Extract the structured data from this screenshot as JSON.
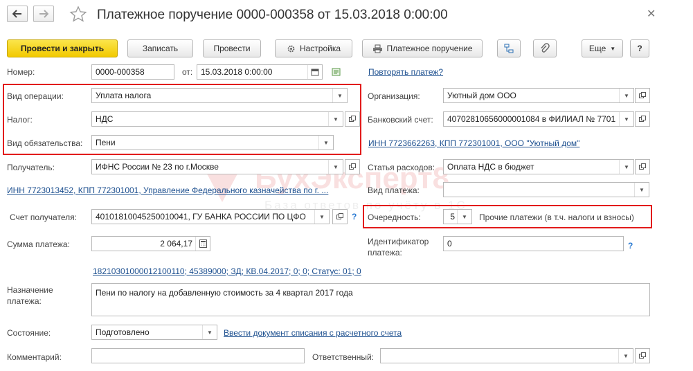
{
  "title": "Платежное поручение 0000-000358 от 15.03.2018 0:00:00",
  "toolbar": {
    "post_close": "Провести и закрыть",
    "save": "Записать",
    "post": "Провести",
    "settings": "Настройка",
    "print": "Платежное поручение",
    "more": "Еще",
    "help": "?"
  },
  "form": {
    "number_label": "Номер:",
    "number": "0000-000358",
    "date_label": "от:",
    "date": "15.03.2018  0:00:00",
    "repeat_link": "Повторять платеж?",
    "op_type_label": "Вид операции:",
    "op_type": "Уплата налога",
    "tax_label": "Налог:",
    "tax": "НДС",
    "obligation_label": "Вид обязательства:",
    "obligation": "Пени",
    "org_label": "Организация:",
    "org": "Уютный дом ООО",
    "bank_label": "Банковский счет:",
    "bank": "40702810656000001084 в ФИЛИАЛ № 7701",
    "org_inn_link": "ИНН 7723662263, КПП 772301001, ООО \"Уютный дом\"",
    "recipient_label": "Получатель:",
    "recipient": "ИФНС России № 23 по г.Москве",
    "recipient_link": "ИНН 7723013452, КПП 772301001, Управление Федерального казначейства по г. ...",
    "expense_label": "Статья расходов:",
    "expense": "Оплата НДС в бюджет",
    "payment_type_label": "Вид платежа:",
    "payment_type": "",
    "account_label": "Счет получателя:",
    "account": "40101810045250010041, ГУ БАНКА РОССИИ ПО ЦФО",
    "priority_label": "Очередность:",
    "priority": "5",
    "priority_desc": "Прочие платежи (в т.ч. налоги и взносы)",
    "amount_label": "Сумма платежа:",
    "amount": "2 064,17",
    "identifier_label_1": "Идентификатор",
    "identifier_label_2": "платежа:",
    "identifier": "0",
    "kbk_link": "18210301000012100110; 45389000; ЗД; КВ.04.2017; 0; 0; Статус: 01; 0",
    "purpose_label_1": "Назначение",
    "purpose_label_2": "платежа:",
    "purpose": "Пени по налогу на добавленную стоимость за 4 квартал 2017 года",
    "state_label": "Состояние:",
    "state": "Подготовлено",
    "writeoff_link": "Ввести документ списания с расчетного счета",
    "comment_label": "Комментарий:",
    "comment": "",
    "responsible_label": "Ответственный:",
    "responsible": ""
  },
  "watermark": {
    "brand": "БухЭксперт8",
    "tagline": "База ответов по учёту в 1С"
  },
  "colors": {
    "primary_button": "#f5d20a",
    "highlight_box": "#e21b1b",
    "link": "#1c4f8f"
  },
  "icons": [
    "back-arrow-icon",
    "forward-arrow-icon",
    "star-icon",
    "close-icon",
    "gear-icon",
    "printer-icon",
    "structure-icon",
    "paperclip-icon",
    "calendar-icon",
    "calculator-icon",
    "open-icon",
    "dropdown-icon",
    "question-icon"
  ]
}
